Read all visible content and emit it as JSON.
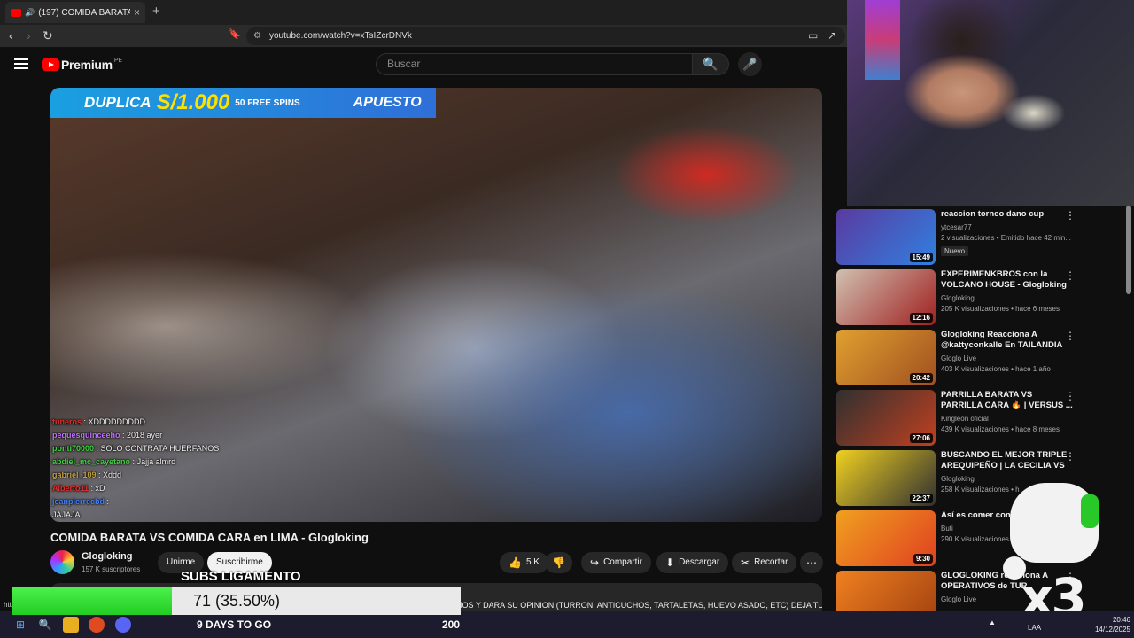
{
  "browser": {
    "tab_title": "(197) COMIDA BARATA VS CO",
    "tab_close": "×",
    "new_tab": "+",
    "url": "youtube.com/watch?v=xTsIZcrDNVk"
  },
  "masthead": {
    "logo_text": "Premium",
    "region": "PE",
    "search_placeholder": "Buscar"
  },
  "video": {
    "banner": {
      "line1": "DUPLICA",
      "amount": "S/1.000",
      "spins": "50 FREE SPINS",
      "brand": "APUESTO"
    },
    "chat": [
      {
        "user": "tuneros",
        "color": "#e03030",
        "msg": "XDDDDDDDDD"
      },
      {
        "user": "pequesquinceeho",
        "color": "#c070ff",
        "msg": "2018 ayer"
      },
      {
        "user": "ponti70000",
        "color": "#40d040",
        "msg": "SOLO CONTRATA HUERFANOS"
      },
      {
        "user": "abdiel_mc_cayetano",
        "color": "#40d040",
        "msg": "Jajja almrd"
      },
      {
        "user": "gabriel_109",
        "color": "#c0a040",
        "msg": "Xddd"
      },
      {
        "user": "Alberto11",
        "color": "#e03030",
        "msg": "xD"
      },
      {
        "user": "jeanpierrecbd",
        "color": "#4080ff",
        "msg": ""
      },
      {
        "user": "",
        "color": "#ffffff",
        "msg": "JAJAJA"
      }
    ],
    "title": "COMIDA BARATA VS COMIDA CARA en LIMA - Glogloking",
    "channel": "Glogloking",
    "subscribers": "157 K suscriptores",
    "join_label": "Unirme",
    "subscribe_label": "Suscribirme",
    "likes": "5 K",
    "share_label": "Compartir",
    "download_label": "Descargar",
    "clip_label": "Recortar",
    "description_snippet": "IOS Y DARA SU OPINION (TURRON, ANTICUCHOS, TARTALETAS, HUEVO ASADO, ETC) DEJA TU"
  },
  "recommendations": [
    {
      "title": "reaccion torneo dano cup",
      "channel": "ytcesar77",
      "meta": "2 visualizaciones • Emitido hace 42 min...",
      "badge": "Nuevo",
      "duration": "15:49",
      "colors": [
        "#5a3aa0",
        "#3080e0"
      ]
    },
    {
      "title": "EXPERIMENKBROS con la VOLCANO  HOUSE - Glogloking",
      "channel": "Glogloking",
      "meta": "205 K visualizaciones • hace 6 meses",
      "badge": "",
      "duration": "12:16",
      "colors": [
        "#d0c0b0",
        "#a02020"
      ]
    },
    {
      "title": "Glogloking Reacciona A @kattyconkalle En TAILANDIA",
      "channel": "Gloglo Live",
      "meta": "403 K visualizaciones • hace 1 año",
      "badge": "",
      "duration": "20:42",
      "colors": [
        "#e0a030",
        "#a05020"
      ]
    },
    {
      "title": "PARRILLA BARATA VS PARRILLA CARA 🔥 | VERSUS ...",
      "channel": "Kingleon oficial",
      "meta": "439 K visualizaciones • hace 8 meses",
      "badge": "",
      "duration": "27:06",
      "colors": [
        "#303030",
        "#c04020"
      ]
    },
    {
      "title": "BUSCANDO EL MEJOR TRIPLE AREQUIPEÑO | LA CECILIA VS ...",
      "channel": "Glogloking",
      "meta": "258 K visualizaciones • h",
      "badge": "",
      "duration": "22:37",
      "colors": [
        "#f0d020",
        "#303030"
      ]
    },
    {
      "title": "Así es comer con t",
      "channel": "Buti",
      "meta": "290 K visualizaciones",
      "badge": "",
      "duration": "9:30",
      "colors": [
        "#f0a020",
        "#e04020"
      ]
    },
    {
      "title": "GLOGLOKING reacciona A OPERATIVOS de TUR",
      "channel": "Gloglo Live",
      "meta": "",
      "badge": "",
      "duration": "",
      "colors": [
        "#f08020",
        "#a04010"
      ]
    }
  ],
  "subs_goal": {
    "title": "SUBS LIGAMENTO",
    "progress_text": "71 (35.50%)",
    "progress_fraction": 0.355,
    "days_left": "9 DAYS TO GO",
    "target": "200"
  },
  "taskbar": {
    "language": "LAA",
    "time": "20:46",
    "date": "14/12/2025",
    "left_text": "htt"
  }
}
